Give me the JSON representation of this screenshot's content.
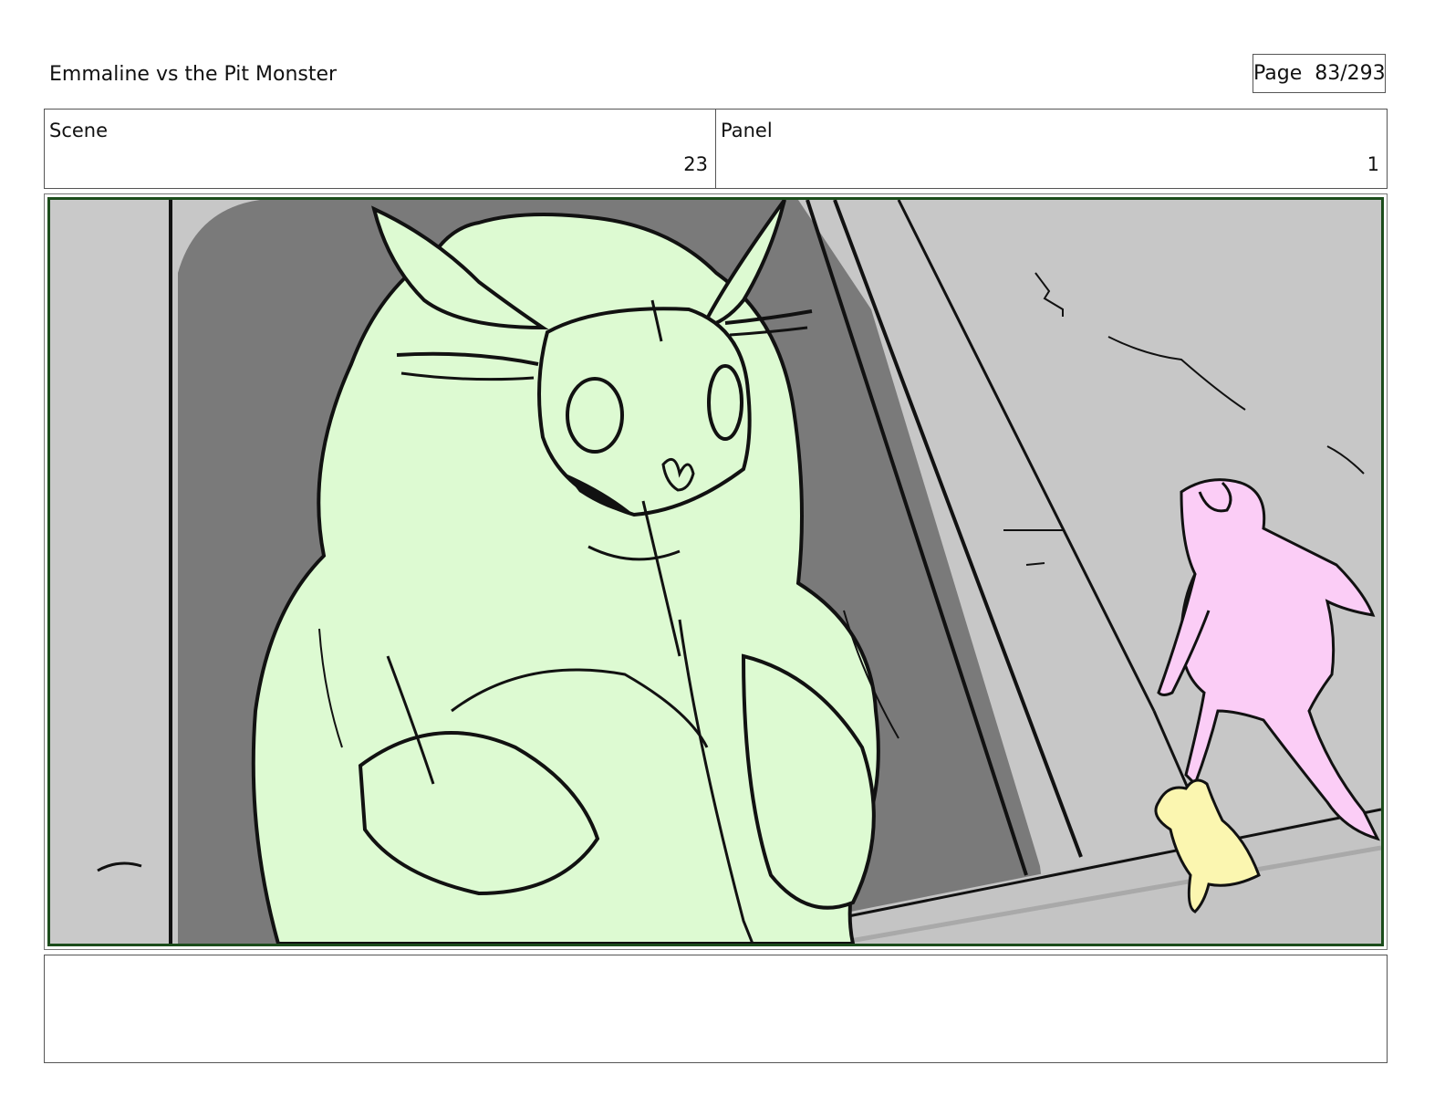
{
  "header": {
    "title": "Emmaline vs the Pit Monster",
    "page_label": "Page",
    "page_number": "83/293"
  },
  "info": {
    "scene_label": "Scene",
    "scene_value": "23",
    "panel_label": "Panel",
    "panel_value": "1"
  },
  "frame": {
    "border_color": "#1c4d1c",
    "colors": {
      "wall_light": "#c7c7c7",
      "shadow_dark": "#7a7a7a",
      "monster_fill": "#ddfad2",
      "girl_fill": "#fbcdf6",
      "pet_fill": "#fbf6b0",
      "ink": "#111111"
    }
  },
  "notes": {
    "text": ""
  }
}
